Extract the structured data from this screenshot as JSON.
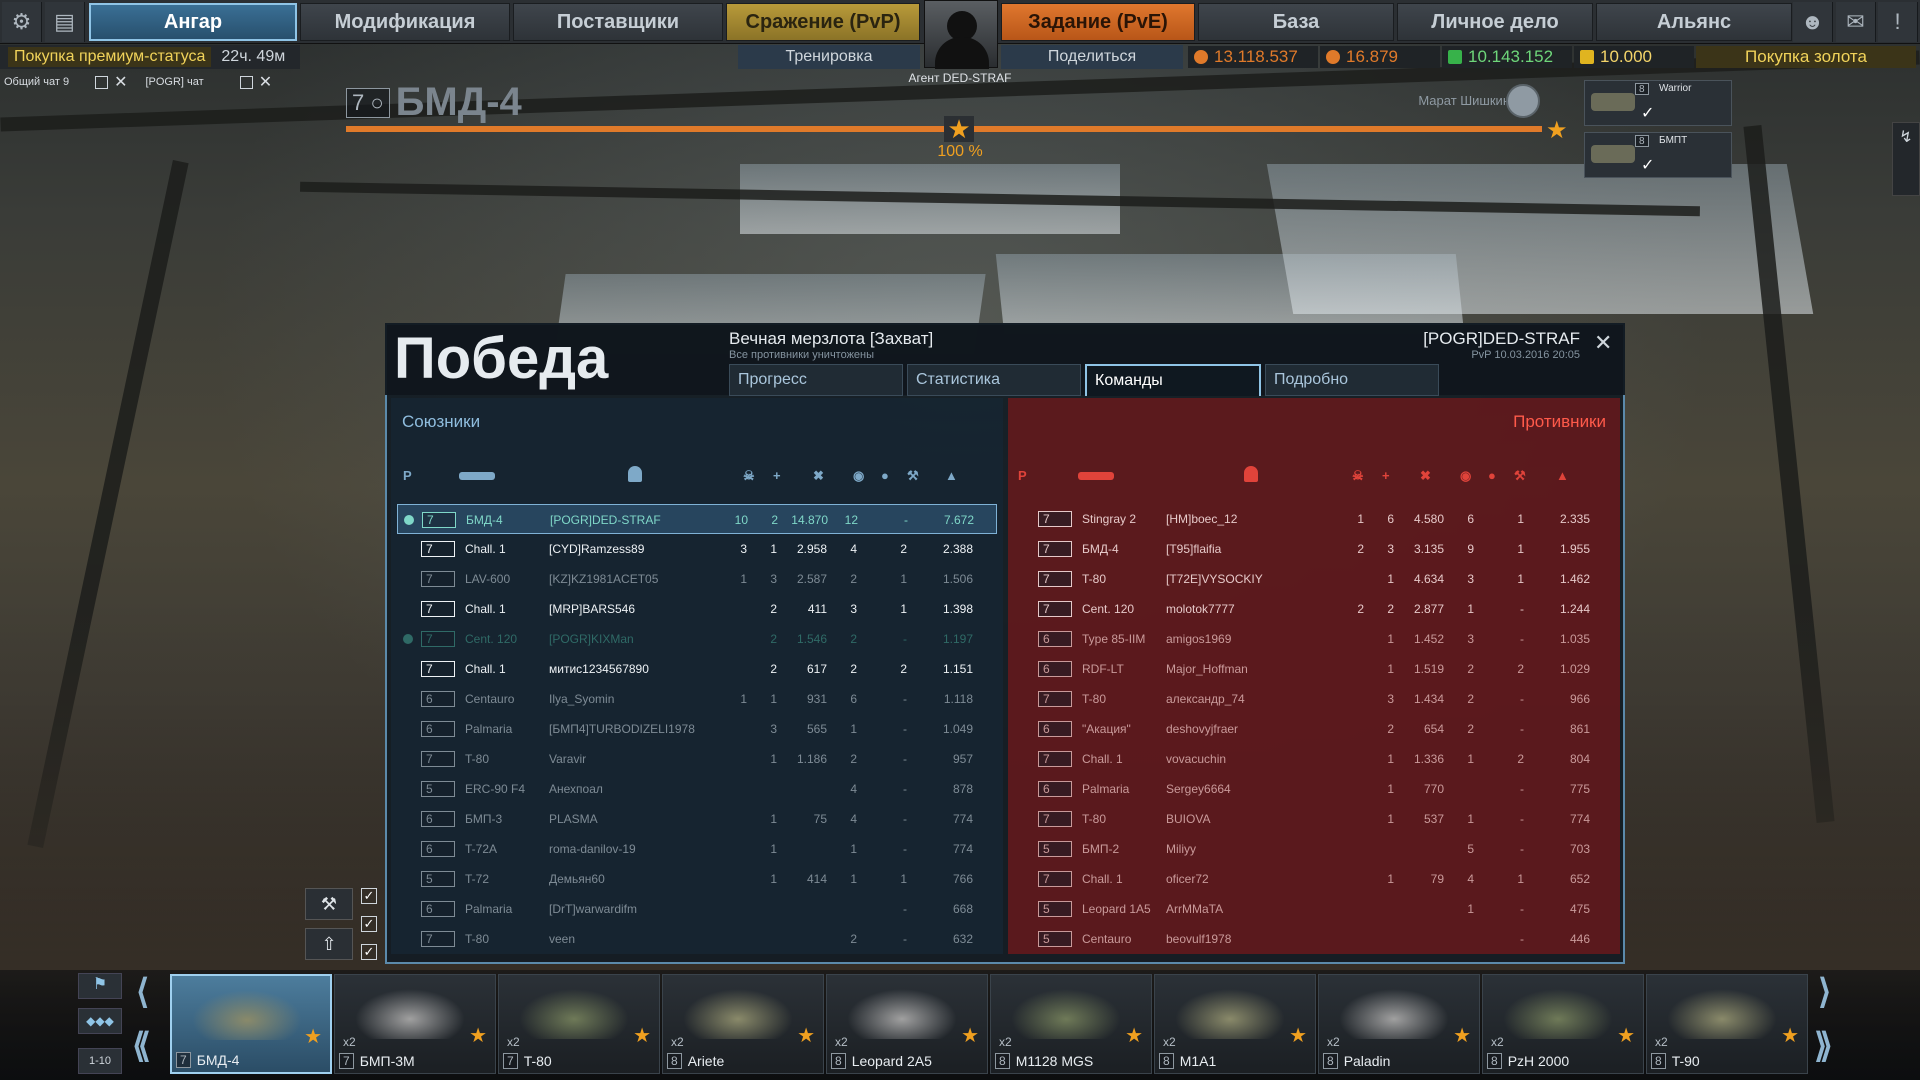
{
  "topbar": {
    "tabs": [
      {
        "label": "Ангар"
      },
      {
        "label": "Модификация"
      },
      {
        "label": "Поставщики"
      },
      {
        "label": "Сражение (PvP)"
      },
      {
        "label": "Задание (PvE)"
      },
      {
        "label": "База"
      },
      {
        "label": "Личное дело"
      },
      {
        "label": "Альянс"
      }
    ],
    "agent_name": "Агент DED-STRAF",
    "training_label": "Тренировка",
    "share_label": "Поделиться",
    "premium_label": "Покупка премиум-статуса",
    "premium_time": "22ч. 49м",
    "resources": [
      {
        "value": "13.118.537",
        "color": "#e07a2a"
      },
      {
        "value": "16.879",
        "color": "#e07a2a"
      },
      {
        "value": "10.143.152",
        "color": "#37b24a"
      },
      {
        "value": "10.000",
        "color": "#e0b420"
      }
    ],
    "buy_gold_label": "Покупка золота"
  },
  "chat": {
    "general": "Общий чат 9",
    "clan": "[POGR] чат"
  },
  "vehicle": {
    "rank": "7",
    "name": "БМД-4",
    "progress_label": "100 %",
    "commander": "Марат Шишкин"
  },
  "queue": [
    {
      "rank": "8",
      "name": "Warrior"
    },
    {
      "rank": "8",
      "name": "БМПТ"
    }
  ],
  "result": {
    "title": "Победа",
    "map": "Вечная мерзлота [Захват]",
    "subtitle": "Все противники уничтожены",
    "player": "[POGR]DED-STRAF",
    "meta": "PvP 10.03.2016 20:05",
    "tabs": [
      "Прогресс",
      "Статистика",
      "Команды",
      "Подробно"
    ],
    "allies_label": "Союзники",
    "enemies_label": "Противники"
  },
  "allies": [
    {
      "rank": "7",
      "veh": "БМД-4",
      "player": "[POGR]DED-STRAF",
      "k": "10",
      "a": "2",
      "dmg": "14.870",
      "spot": "12",
      "cap": "",
      "rep": "-",
      "score": "7.672",
      "style": "hl"
    },
    {
      "rank": "7",
      "veh": "Chall. 1",
      "player": "[CYD]Ramzess89",
      "k": "3",
      "a": "1",
      "dmg": "2.958",
      "spot": "4",
      "cap": "",
      "rep": "2",
      "score": "2.388",
      "style": "bright"
    },
    {
      "rank": "7",
      "veh": "LAV-600",
      "player": "[KZ]KZ1981ACET05",
      "k": "1",
      "a": "3",
      "dmg": "2.587",
      "spot": "2",
      "cap": "",
      "rep": "1",
      "score": "1.506",
      "style": "dim"
    },
    {
      "rank": "7",
      "veh": "Chall. 1",
      "player": "[MRP]BARS546",
      "k": "",
      "a": "2",
      "dmg": "411",
      "spot": "3",
      "cap": "",
      "rep": "1",
      "score": "1.398",
      "style": "bright"
    },
    {
      "rank": "7",
      "veh": "Cent. 120",
      "player": "[POGR]KIXMan",
      "k": "",
      "a": "2",
      "dmg": "1.546",
      "spot": "2",
      "cap": "",
      "rep": "-",
      "score": "1.197",
      "style": "teal"
    },
    {
      "rank": "7",
      "veh": "Chall. 1",
      "player": "митис1234567890",
      "k": "",
      "a": "2",
      "dmg": "617",
      "spot": "2",
      "cap": "",
      "rep": "2",
      "score": "1.151",
      "style": "bright"
    },
    {
      "rank": "6",
      "veh": "Centauro",
      "player": "Ilya_Syomin",
      "k": "1",
      "a": "1",
      "dmg": "931",
      "spot": "6",
      "cap": "",
      "rep": "-",
      "score": "1.118",
      "style": "dim"
    },
    {
      "rank": "6",
      "veh": "Palmaria",
      "player": "[БМП4]TURBODIZELI1978",
      "k": "",
      "a": "3",
      "dmg": "565",
      "spot": "1",
      "cap": "",
      "rep": "-",
      "score": "1.049",
      "style": "dim"
    },
    {
      "rank": "7",
      "veh": "T-80",
      "player": "Varavir",
      "k": "",
      "a": "1",
      "dmg": "1.186",
      "spot": "2",
      "cap": "",
      "rep": "-",
      "score": "957",
      "style": "dim"
    },
    {
      "rank": "5",
      "veh": "ERC-90 F4",
      "player": "Анехпоал",
      "k": "",
      "a": "",
      "dmg": "",
      "spot": "4",
      "cap": "",
      "rep": "-",
      "score": "878",
      "style": "dim"
    },
    {
      "rank": "6",
      "veh": "БМП-3",
      "player": "PLASMA",
      "k": "",
      "a": "1",
      "dmg": "75",
      "spot": "4",
      "cap": "",
      "rep": "-",
      "score": "774",
      "style": "dim"
    },
    {
      "rank": "6",
      "veh": "T-72A",
      "player": "roma-danilov-19",
      "k": "",
      "a": "1",
      "dmg": "",
      "spot": "1",
      "cap": "",
      "rep": "-",
      "score": "774",
      "style": "dim"
    },
    {
      "rank": "5",
      "veh": "T-72",
      "player": "Демьян60",
      "k": "",
      "a": "1",
      "dmg": "414",
      "spot": "1",
      "cap": "",
      "rep": "1",
      "score": "766",
      "style": "dim"
    },
    {
      "rank": "6",
      "veh": "Palmaria",
      "player": "[DrT]warwardifm",
      "k": "",
      "a": "",
      "dmg": "",
      "spot": "",
      "cap": "",
      "rep": "-",
      "score": "668",
      "style": "dim"
    },
    {
      "rank": "7",
      "veh": "T-80",
      "player": "veen",
      "k": "",
      "a": "",
      "dmg": "",
      "spot": "2",
      "cap": "",
      "rep": "-",
      "score": "632",
      "style": "dim"
    }
  ],
  "enemies": [
    {
      "rank": "7",
      "veh": "Stingray 2",
      "player": "[HM]boec_12",
      "k": "1",
      "a": "6",
      "dmg": "4.580",
      "spot": "6",
      "cap": "",
      "rep": "1",
      "score": "2.335"
    },
    {
      "rank": "7",
      "veh": "БМД-4",
      "player": "[T95]flaifia",
      "k": "2",
      "a": "3",
      "dmg": "3.135",
      "spot": "9",
      "cap": "",
      "rep": "1",
      "score": "1.955"
    },
    {
      "rank": "7",
      "veh": "T-80",
      "player": "[T72E]VYSOCKIY",
      "k": "",
      "a": "1",
      "dmg": "4.634",
      "spot": "3",
      "cap": "",
      "rep": "1",
      "score": "1.462"
    },
    {
      "rank": "7",
      "veh": "Cent. 120",
      "player": "molotok7777",
      "k": "2",
      "a": "2",
      "dmg": "2.877",
      "spot": "1",
      "cap": "",
      "rep": "-",
      "score": "1.244"
    },
    {
      "rank": "6",
      "veh": "Type 85-IIM",
      "player": "amigos1969",
      "k": "",
      "a": "1",
      "dmg": "1.452",
      "spot": "3",
      "cap": "",
      "rep": "-",
      "score": "1.035"
    },
    {
      "rank": "6",
      "veh": "RDF-LT",
      "player": "Major_Hoffman",
      "k": "",
      "a": "1",
      "dmg": "1.519",
      "spot": "2",
      "cap": "",
      "rep": "2",
      "score": "1.029"
    },
    {
      "rank": "7",
      "veh": "T-80",
      "player": "александр_74",
      "k": "",
      "a": "3",
      "dmg": "1.434",
      "spot": "2",
      "cap": "",
      "rep": "-",
      "score": "966"
    },
    {
      "rank": "6",
      "veh": "\"Акация\"",
      "player": "deshovyjfraer",
      "k": "",
      "a": "2",
      "dmg": "654",
      "spot": "2",
      "cap": "",
      "rep": "-",
      "score": "861"
    },
    {
      "rank": "7",
      "veh": "Chall. 1",
      "player": "vovacuchin",
      "k": "",
      "a": "1",
      "dmg": "1.336",
      "spot": "1",
      "cap": "",
      "rep": "2",
      "score": "804"
    },
    {
      "rank": "6",
      "veh": "Palmaria",
      "player": "Sergey6664",
      "k": "",
      "a": "1",
      "dmg": "770",
      "spot": "",
      "cap": "",
      "rep": "-",
      "score": "775"
    },
    {
      "rank": "7",
      "veh": "T-80",
      "player": "BUIOVA",
      "k": "",
      "a": "1",
      "dmg": "537",
      "spot": "1",
      "cap": "",
      "rep": "-",
      "score": "774"
    },
    {
      "rank": "5",
      "veh": "БМП-2",
      "player": "Miliyy",
      "k": "",
      "a": "",
      "dmg": "",
      "spot": "5",
      "cap": "",
      "rep": "-",
      "score": "703"
    },
    {
      "rank": "7",
      "veh": "Chall. 1",
      "player": "oficer72",
      "k": "",
      "a": "1",
      "dmg": "79",
      "spot": "4",
      "cap": "",
      "rep": "1",
      "score": "652"
    },
    {
      "rank": "5",
      "veh": "Leopard 1A5",
      "player": "ArrMMaTA",
      "k": "",
      "a": "",
      "dmg": "",
      "spot": "1",
      "cap": "",
      "rep": "-",
      "score": "475"
    },
    {
      "rank": "5",
      "veh": "Centauro",
      "player": "beovulf1978",
      "k": "",
      "a": "",
      "dmg": "",
      "spot": "",
      "cap": "",
      "rep": "-",
      "score": "446"
    }
  ],
  "sidebar_filter": {
    "range_label": "1-10"
  },
  "carousel": [
    {
      "rank": "7",
      "name": "БМД-4",
      "mult": ""
    },
    {
      "rank": "7",
      "name": "БМП-3М",
      "mult": "x2"
    },
    {
      "rank": "7",
      "name": "T-80",
      "mult": "x2"
    },
    {
      "rank": "8",
      "name": "Ariete",
      "mult": "x2"
    },
    {
      "rank": "8",
      "name": "Leopard 2A5",
      "mult": "x2"
    },
    {
      "rank": "8",
      "name": "M1128 MGS",
      "mult": "x2"
    },
    {
      "rank": "8",
      "name": "M1A1",
      "mult": "x2"
    },
    {
      "rank": "8",
      "name": "Paladin",
      "mult": "x2"
    },
    {
      "rank": "8",
      "name": "PzH 2000",
      "mult": "x2"
    },
    {
      "rank": "8",
      "name": "T-90",
      "mult": "x2"
    }
  ]
}
